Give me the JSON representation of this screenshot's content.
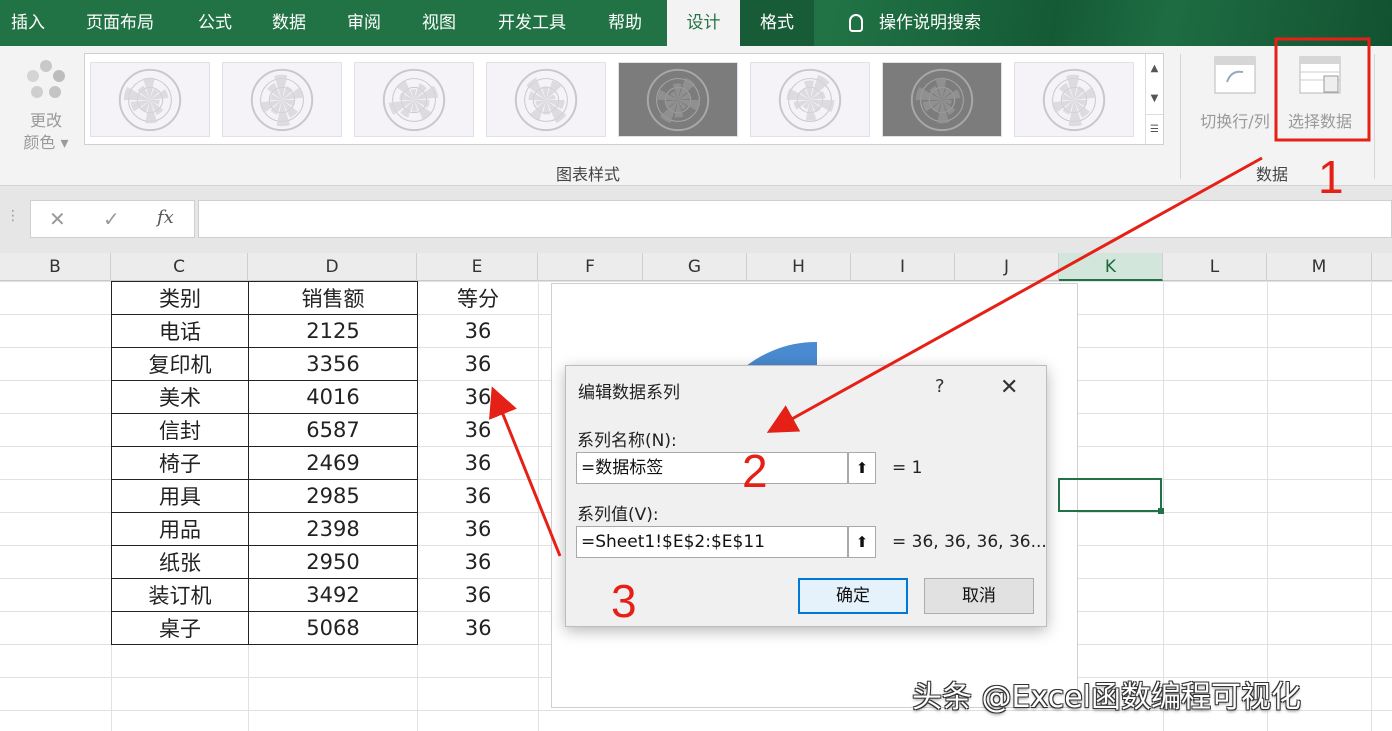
{
  "ribbon": {
    "tabs": [
      "插入",
      "页面布局",
      "公式",
      "数据",
      "审阅",
      "视图",
      "开发工具",
      "帮助",
      "设计",
      "格式"
    ],
    "active_tab": "设计",
    "tell_me": "操作说明搜索",
    "change_colors": {
      "line1": "更改",
      "line2": "颜色"
    },
    "gallery_label": "图表样式",
    "switch_row_col": "切换行/列",
    "select_data": "选择数据",
    "data_group_label": "数据"
  },
  "formula_bar": {
    "cancel": "✕",
    "enter": "✓",
    "fx": "fx",
    "value": ""
  },
  "columns": [
    "B",
    "C",
    "D",
    "E",
    "F",
    "G",
    "H",
    "I",
    "J",
    "K",
    "L",
    "M"
  ],
  "selected_column": "K",
  "table": {
    "headers": [
      "类别",
      "销售额",
      "等分"
    ],
    "rows": [
      [
        "电话",
        "2125",
        "36"
      ],
      [
        "复印机",
        "3356",
        "36"
      ],
      [
        "美术",
        "4016",
        "36"
      ],
      [
        "信封",
        "6587",
        "36"
      ],
      [
        "椅子",
        "2469",
        "36"
      ],
      [
        "用具",
        "2985",
        "36"
      ],
      [
        "用品",
        "2398",
        "36"
      ],
      [
        "纸张",
        "2950",
        "36"
      ],
      [
        "装订机",
        "3492",
        "36"
      ],
      [
        "桌子",
        "5068",
        "36"
      ]
    ]
  },
  "dialog": {
    "title": "编辑数据系列",
    "help": "?",
    "close": "✕",
    "name_label": "系列名称(N):",
    "name_value": "=数据标签",
    "name_result": "= 1",
    "values_label": "系列值(V):",
    "values_value": "=Sheet1!$E$2:$E$11",
    "values_result": "= 36, 36, 36, 36...",
    "ok": "确定",
    "cancel": "取消"
  },
  "annotations": {
    "step1": "1",
    "step2": "2",
    "step3": "3"
  },
  "watermark": "头条 @Excel函数编程可视化",
  "colors": {
    "excel_green": "#217346",
    "annotation_red": "#e52016",
    "chart_blue": "#4a8ad0"
  }
}
